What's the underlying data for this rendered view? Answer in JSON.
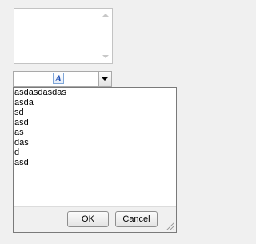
{
  "listbox": {
    "scroll_up_icon": "scroll-up-arrow",
    "scroll_down_icon": "scroll-down-arrow"
  },
  "combo": {
    "icon": "font-color-icon",
    "icon_glyph": "A",
    "dropdown_icon": "chevron-down-icon"
  },
  "popup": {
    "items": [
      "asdasdasdas",
      "asda",
      "sd",
      "asd",
      "as",
      "das",
      "d",
      "asd"
    ],
    "ok_label": "OK",
    "cancel_label": "Cancel",
    "resize_icon": "resize-grip-icon"
  }
}
